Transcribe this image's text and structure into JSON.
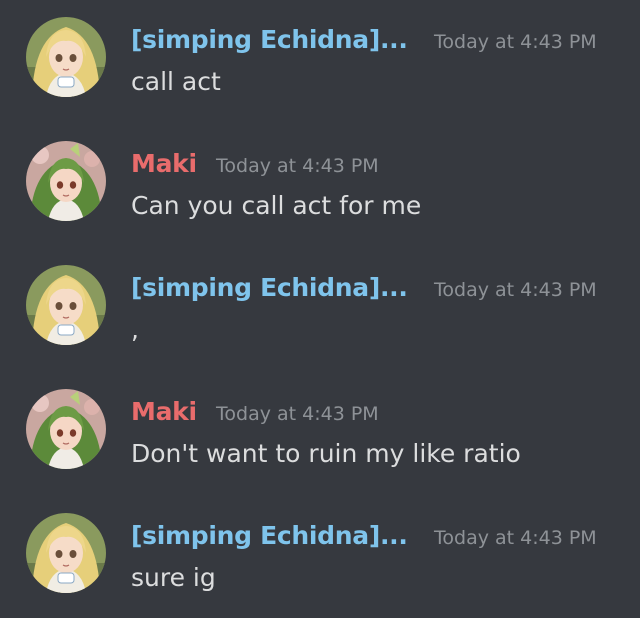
{
  "colors": {
    "background": "#36393f",
    "username_echidna": "#7fc4ec",
    "username_maki": "#e96c6c",
    "timestamp": "#8e9297",
    "text": "#dcddde"
  },
  "messages": [
    {
      "author": "[simping Echidna]...",
      "timestamp": "Today at 4:43 PM",
      "content": "call act",
      "avatar": "blonde-anime-girl-avatar"
    },
    {
      "author": "Maki",
      "timestamp": "Today at 4:43 PM",
      "content": "Can you call act for me",
      "avatar": "green-haired-anime-girl-avatar"
    },
    {
      "author": "[simping Echidna]...",
      "timestamp": "Today at 4:43 PM",
      "content": ",",
      "avatar": "blonde-anime-girl-avatar"
    },
    {
      "author": "Maki",
      "timestamp": "Today at 4:43 PM",
      "content": "Don't want to ruin my like ratio",
      "avatar": "green-haired-anime-girl-avatar"
    },
    {
      "author": "[simping Echidna]...",
      "timestamp": "Today at 4:43 PM",
      "content": "sure ig",
      "avatar": "blonde-anime-girl-avatar"
    }
  ]
}
